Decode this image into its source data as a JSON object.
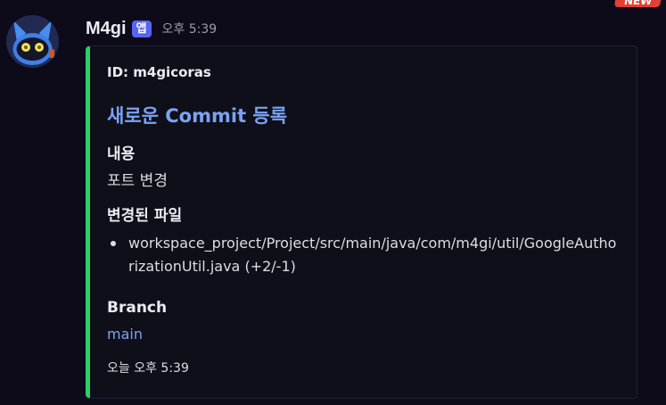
{
  "badge": {
    "new": "NEW"
  },
  "message": {
    "username": "M4gi",
    "app_tag": "앱",
    "timestamp": "오후 5:39"
  },
  "embed": {
    "accent_color": "#2ccf63",
    "author": "ID: m4gicoras",
    "title": "새로운 Commit 등록",
    "fields": {
      "content_name": "내용",
      "content_value": "포트 변경",
      "files_name": "변경된 파일",
      "files": [
        "workspace_project/Project/src/main/java/com/m4gi/util/GoogleAuthorizationUtil.java (+2/-1)"
      ],
      "branch_name": "Branch",
      "branch_value": "main"
    },
    "footer": "오늘 오후 5:39"
  },
  "icons": {
    "avatar": "robot-avatar-icon"
  }
}
